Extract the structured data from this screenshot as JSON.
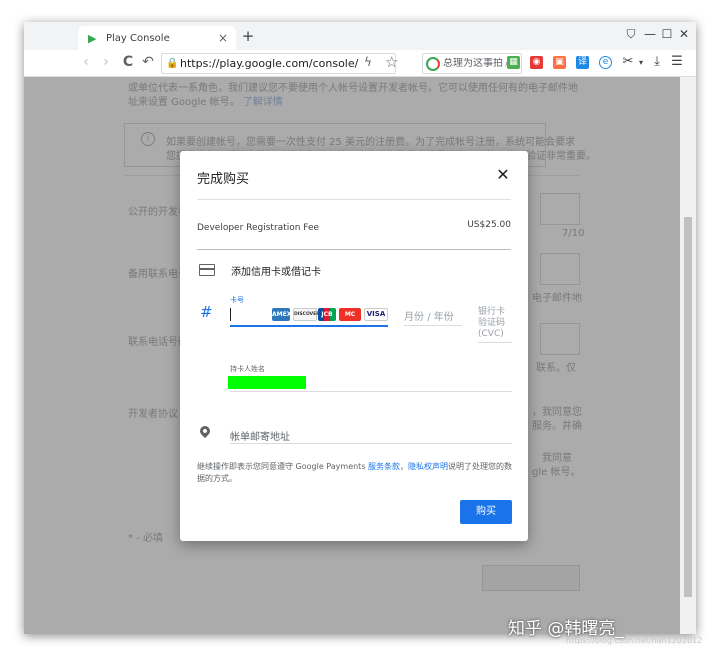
{
  "browser": {
    "tab_title": "Play Console",
    "tab_close": "×",
    "new_tab": "+",
    "url": "https://play.google.com/console/",
    "search_placeholder": "总理为这事拍桌",
    "window_buttons": [
      "⛉",
      "—",
      "☐",
      "✕"
    ],
    "nav": {
      "back": "‹",
      "forward": "›",
      "reload": "C",
      "home": "↶"
    }
  },
  "background_page": {
    "lines": [
      "或单位代表一系角色，我们建议您不要使用个人帐号设置开发者帐号。它可以使用任何有的电子邮件地",
      "址来设置 Google 帐号。",
      "如果要创建帐号，您需要一次性支付 25 美元的注册费。为了完成帐号注册，系统可能会要求",
      "您提供身份证明等文件，以核实您的身份。请确保您的信息都是准确无误的，这对验证非常重要。",
      "公开的开发者",
      "备用联系电子",
      "联系电话号码",
      "开发者协议",
      "* - 必填"
    ],
    "learn_more": "了解详情",
    "counter": "7/10",
    "right_texts": [
      "电子邮件地",
      "联系。仅",
      "，我同意您",
      "服务。并确",
      "我同意",
      "gle 帐号。"
    ]
  },
  "dialog": {
    "title": "完成购买",
    "close": "✕",
    "fee_label": "Developer Registration Fee",
    "fee_amount": "US$25.00",
    "add_card": "添加信用卡或借记卡",
    "card_number_label": "卡号",
    "card_brands": [
      "AMEX",
      "DISCOVER",
      "JCB",
      "MC",
      "VISA"
    ],
    "expiry_month": "月份",
    "expiry_sep": "/",
    "expiry_year": "年份",
    "cvc_label": "银行卡验证码 (CVC)",
    "cardholder_label": "持卡人姓名",
    "address_label": "帐单邮寄地址",
    "legal_prefix": "继续操作即表示您同意遵守 Google Payments ",
    "legal_terms": "服务条款",
    "legal_sep": "，",
    "legal_privacy": "隐私权声明",
    "legal_suffix": "说明了处理您的数据的方式。",
    "buy_button": "购买"
  },
  "watermark": {
    "text": "知乎 @韩曙亮_",
    "url": "https://blog.csdn.net/han1202012"
  },
  "colors": {
    "accent": "#1a73e8",
    "redaction": "#00ff00"
  }
}
